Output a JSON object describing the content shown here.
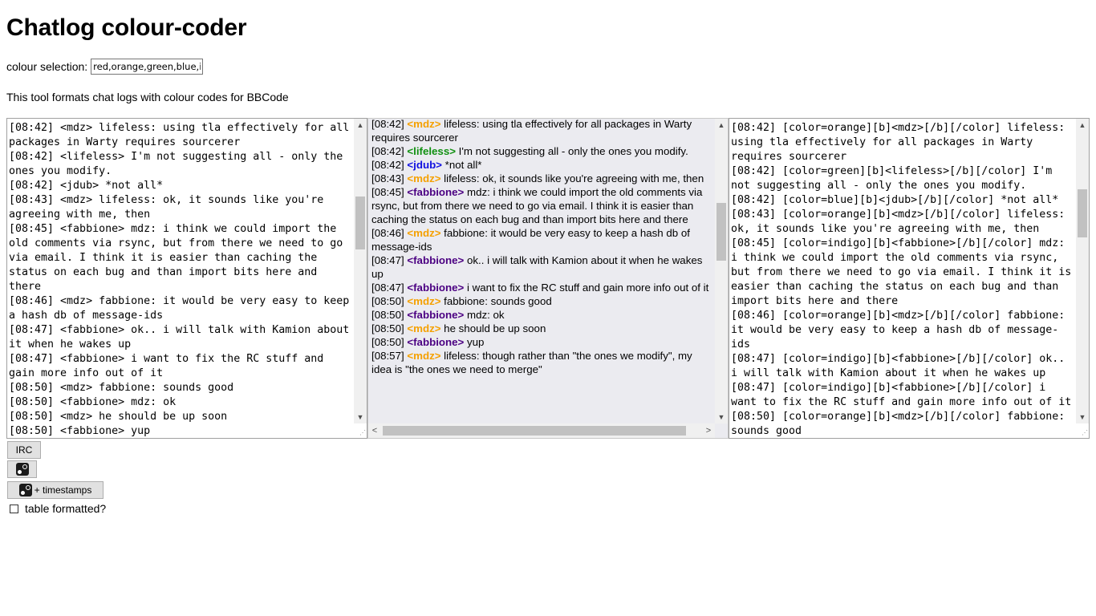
{
  "page": {
    "title": "Chatlog colour-coder"
  },
  "colour_selection": {
    "label": "colour selection:",
    "value": "red,orange,green,blue,in"
  },
  "description": "This tool formats chat logs with colour codes for BBCode",
  "colors": {
    "orange": "#f5a000",
    "green": "#109010",
    "blue": "#1010e0",
    "indigo": "#4b0082"
  },
  "input_log": [
    "[08:42] <mdz> lifeless: using tla effectively for all packages in Warty requires sourcerer",
    "[08:42] <lifeless> I'm not suggesting all - only the ones you modify.",
    "[08:42] <jdub> *not all*",
    "[08:43] <mdz> lifeless: ok, it sounds like you're agreeing with me, then",
    "[08:45] <fabbione> mdz: i think we could import the old comments via rsync, but from there we need to go via email. I think it is easier than caching the status on each bug and than import bits here and there",
    "[08:46] <mdz> fabbione: it would be very easy to keep a hash db of message-ids",
    "[08:47] <fabbione> ok.. i will talk with Kamion about it when he wakes up",
    "[08:47] <fabbione> i want to fix the RC stuff and gain more info out of it",
    "[08:50] <mdz> fabbione: sounds good",
    "[08:50] <fabbione> mdz: ok",
    "[08:50] <mdz> he should be up soon",
    "[08:50] <fabbione> yup"
  ],
  "preview": [
    {
      "time": "[08:42]",
      "nick": "<mdz>",
      "color": "orange",
      "text": "lifeless: using tla effectively for all packages in Warty requires sourcerer"
    },
    {
      "time": "[08:42]",
      "nick": "<lifeless>",
      "color": "green",
      "text": "I'm not suggesting all - only the ones you modify."
    },
    {
      "time": "[08:42]",
      "nick": "<jdub>",
      "color": "blue",
      "text": "*not all*"
    },
    {
      "time": "[08:43]",
      "nick": "<mdz>",
      "color": "orange",
      "text": "lifeless: ok, it sounds like you're agreeing with me, then"
    },
    {
      "time": "[08:45]",
      "nick": "<fabbione>",
      "color": "indigo",
      "text": "mdz: i think we could import the old comments via rsync, but from there we need to go via email. I think it is easier than caching the status on each bug and than import bits here and there"
    },
    {
      "time": "[08:46]",
      "nick": "<mdz>",
      "color": "orange",
      "text": "fabbione: it would be very easy to keep a hash db of message-ids"
    },
    {
      "time": "[08:47]",
      "nick": "<fabbione>",
      "color": "indigo",
      "text": "ok.. i will talk with Kamion about it when he wakes up"
    },
    {
      "time": "[08:47]",
      "nick": "<fabbione>",
      "color": "indigo",
      "text": "i want to fix the RC stuff and gain more info out of it"
    },
    {
      "time": "[08:50]",
      "nick": "<mdz>",
      "color": "orange",
      "text": "fabbione: sounds good"
    },
    {
      "time": "[08:50]",
      "nick": "<fabbione>",
      "color": "indigo",
      "text": "mdz: ok"
    },
    {
      "time": "[08:50]",
      "nick": "<mdz>",
      "color": "orange",
      "text": "he should be up soon"
    },
    {
      "time": "[08:50]",
      "nick": "<fabbione>",
      "color": "indigo",
      "text": "yup"
    },
    {
      "time": "[08:57]",
      "nick": "<mdz>",
      "color": "orange",
      "text": "lifeless: though rather than \"the ones we modify\", my idea is \"the ones we need to merge\""
    }
  ],
  "output_log": [
    "[08:42] [color=orange][b]<mdz>[/b][/color] lifeless: using tla effectively for all packages in Warty requires sourcerer",
    "[08:42] [color=green][b]<lifeless>[/b][/color] I'm not suggesting all - only the ones you modify.",
    "[08:42] [color=blue][b]<jdub>[/b][/color] *not all*",
    "[08:43] [color=orange][b]<mdz>[/b][/color] lifeless: ok, it sounds like you're agreeing with me, then",
    "[08:45] [color=indigo][b]<fabbione>[/b][/color] mdz: i think we could import the old comments via rsync, but from there we need to go via email. I think it is easier than caching the status on each bug and than import bits here and there",
    "[08:46] [color=orange][b]<mdz>[/b][/color] fabbione: it would be very easy to keep a hash db of message-ids",
    "[08:47] [color=indigo][b]<fabbione>[/b][/color] ok.. i will talk with Kamion about it when he wakes up",
    "[08:47] [color=indigo][b]<fabbione>[/b][/color] i want to fix the RC stuff and gain more info out of it",
    "[08:50] [color=orange][b]<mdz>[/b][/color] fabbione: sounds good"
  ],
  "buttons": {
    "irc": "IRC",
    "steam_ts": "+ timestamps"
  },
  "table_checkbox": {
    "label": "table formatted?",
    "checked": false
  }
}
